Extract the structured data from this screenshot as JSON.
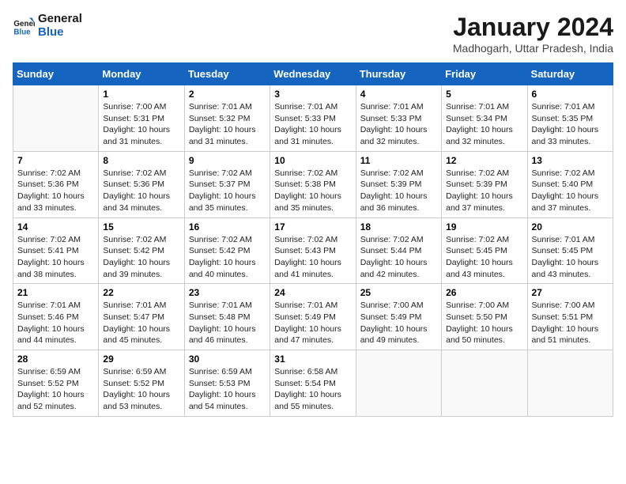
{
  "logo": {
    "line1": "General",
    "line2": "Blue"
  },
  "title": "January 2024",
  "subtitle": "Madhogarh, Uttar Pradesh, India",
  "days_of_week": [
    "Sunday",
    "Monday",
    "Tuesday",
    "Wednesday",
    "Thursday",
    "Friday",
    "Saturday"
  ],
  "weeks": [
    [
      {
        "day": "",
        "info": ""
      },
      {
        "day": "1",
        "info": "Sunrise: 7:00 AM\nSunset: 5:31 PM\nDaylight: 10 hours\nand 31 minutes."
      },
      {
        "day": "2",
        "info": "Sunrise: 7:01 AM\nSunset: 5:32 PM\nDaylight: 10 hours\nand 31 minutes."
      },
      {
        "day": "3",
        "info": "Sunrise: 7:01 AM\nSunset: 5:33 PM\nDaylight: 10 hours\nand 31 minutes."
      },
      {
        "day": "4",
        "info": "Sunrise: 7:01 AM\nSunset: 5:33 PM\nDaylight: 10 hours\nand 32 minutes."
      },
      {
        "day": "5",
        "info": "Sunrise: 7:01 AM\nSunset: 5:34 PM\nDaylight: 10 hours\nand 32 minutes."
      },
      {
        "day": "6",
        "info": "Sunrise: 7:01 AM\nSunset: 5:35 PM\nDaylight: 10 hours\nand 33 minutes."
      }
    ],
    [
      {
        "day": "7",
        "info": "Sunrise: 7:02 AM\nSunset: 5:36 PM\nDaylight: 10 hours\nand 33 minutes."
      },
      {
        "day": "8",
        "info": "Sunrise: 7:02 AM\nSunset: 5:36 PM\nDaylight: 10 hours\nand 34 minutes."
      },
      {
        "day": "9",
        "info": "Sunrise: 7:02 AM\nSunset: 5:37 PM\nDaylight: 10 hours\nand 35 minutes."
      },
      {
        "day": "10",
        "info": "Sunrise: 7:02 AM\nSunset: 5:38 PM\nDaylight: 10 hours\nand 35 minutes."
      },
      {
        "day": "11",
        "info": "Sunrise: 7:02 AM\nSunset: 5:39 PM\nDaylight: 10 hours\nand 36 minutes."
      },
      {
        "day": "12",
        "info": "Sunrise: 7:02 AM\nSunset: 5:39 PM\nDaylight: 10 hours\nand 37 minutes."
      },
      {
        "day": "13",
        "info": "Sunrise: 7:02 AM\nSunset: 5:40 PM\nDaylight: 10 hours\nand 37 minutes."
      }
    ],
    [
      {
        "day": "14",
        "info": "Sunrise: 7:02 AM\nSunset: 5:41 PM\nDaylight: 10 hours\nand 38 minutes."
      },
      {
        "day": "15",
        "info": "Sunrise: 7:02 AM\nSunset: 5:42 PM\nDaylight: 10 hours\nand 39 minutes."
      },
      {
        "day": "16",
        "info": "Sunrise: 7:02 AM\nSunset: 5:42 PM\nDaylight: 10 hours\nand 40 minutes."
      },
      {
        "day": "17",
        "info": "Sunrise: 7:02 AM\nSunset: 5:43 PM\nDaylight: 10 hours\nand 41 minutes."
      },
      {
        "day": "18",
        "info": "Sunrise: 7:02 AM\nSunset: 5:44 PM\nDaylight: 10 hours\nand 42 minutes."
      },
      {
        "day": "19",
        "info": "Sunrise: 7:02 AM\nSunset: 5:45 PM\nDaylight: 10 hours\nand 43 minutes."
      },
      {
        "day": "20",
        "info": "Sunrise: 7:01 AM\nSunset: 5:45 PM\nDaylight: 10 hours\nand 43 minutes."
      }
    ],
    [
      {
        "day": "21",
        "info": "Sunrise: 7:01 AM\nSunset: 5:46 PM\nDaylight: 10 hours\nand 44 minutes."
      },
      {
        "day": "22",
        "info": "Sunrise: 7:01 AM\nSunset: 5:47 PM\nDaylight: 10 hours\nand 45 minutes."
      },
      {
        "day": "23",
        "info": "Sunrise: 7:01 AM\nSunset: 5:48 PM\nDaylight: 10 hours\nand 46 minutes."
      },
      {
        "day": "24",
        "info": "Sunrise: 7:01 AM\nSunset: 5:49 PM\nDaylight: 10 hours\nand 47 minutes."
      },
      {
        "day": "25",
        "info": "Sunrise: 7:00 AM\nSunset: 5:49 PM\nDaylight: 10 hours\nand 49 minutes."
      },
      {
        "day": "26",
        "info": "Sunrise: 7:00 AM\nSunset: 5:50 PM\nDaylight: 10 hours\nand 50 minutes."
      },
      {
        "day": "27",
        "info": "Sunrise: 7:00 AM\nSunset: 5:51 PM\nDaylight: 10 hours\nand 51 minutes."
      }
    ],
    [
      {
        "day": "28",
        "info": "Sunrise: 6:59 AM\nSunset: 5:52 PM\nDaylight: 10 hours\nand 52 minutes."
      },
      {
        "day": "29",
        "info": "Sunrise: 6:59 AM\nSunset: 5:52 PM\nDaylight: 10 hours\nand 53 minutes."
      },
      {
        "day": "30",
        "info": "Sunrise: 6:59 AM\nSunset: 5:53 PM\nDaylight: 10 hours\nand 54 minutes."
      },
      {
        "day": "31",
        "info": "Sunrise: 6:58 AM\nSunset: 5:54 PM\nDaylight: 10 hours\nand 55 minutes."
      },
      {
        "day": "",
        "info": ""
      },
      {
        "day": "",
        "info": ""
      },
      {
        "day": "",
        "info": ""
      }
    ]
  ]
}
